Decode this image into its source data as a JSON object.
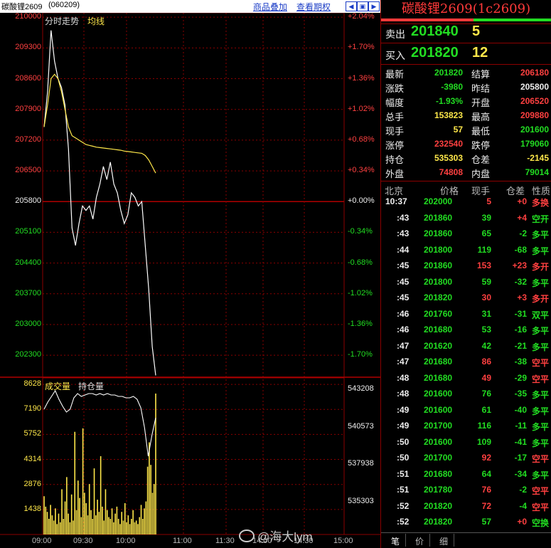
{
  "header": {
    "instrument": "碳酸锂2609",
    "code": "(060209)",
    "link_overlay": "商品叠加",
    "link_history": "查看期权"
  },
  "chart_data": [
    {
      "type": "line",
      "labels": [
        "分时走势",
        "均线"
      ],
      "x_ticks": [
        "09:00",
        "09:30",
        "10:00",
        "11:00",
        "11:30",
        "14:00",
        "14:30",
        "15:00"
      ],
      "y_ticks": [
        210000,
        209300,
        208600,
        207900,
        207200,
        206500,
        205800,
        205100,
        204400,
        203700,
        203000,
        202300
      ],
      "pct_ticks": [
        "+2.04%",
        "+1.70%",
        "+1.36%",
        "+1.02%",
        "+0.68%",
        "+0.34%",
        "+0.00%",
        "-0.34%",
        "-0.68%",
        "-1.02%",
        "-1.36%",
        "-1.70%"
      ],
      "baseline": 205800,
      "ylim": [
        201800,
        210100
      ],
      "series": [
        {
          "name": "分时走势",
          "color": "#ffffff",
          "values": [
            207500,
            208300,
            209700,
            209000,
            208600,
            208400,
            208000,
            207000,
            205200,
            204800,
            205300,
            205700,
            205600,
            205700,
            205400,
            205900,
            206200,
            206600,
            206300,
            206700,
            206200,
            206000,
            205600,
            205300,
            205500,
            206000,
            205900,
            205700,
            205800,
            204800,
            203800,
            202500,
            201840
          ]
        },
        {
          "name": "均线",
          "color": "#ffe84a",
          "values": [
            207500,
            208000,
            208600,
            208700,
            208600,
            208300,
            207900,
            207500,
            207300,
            207250,
            207200,
            207150,
            207100,
            207080,
            207060,
            207040,
            207030,
            207020,
            207010,
            207000,
            206990,
            206980,
            206970,
            206950,
            206940,
            206930,
            206920,
            206910,
            206900,
            206850,
            206750,
            206600,
            206450
          ]
        }
      ]
    },
    {
      "type": "bar",
      "labels": [
        "成交量",
        "持仓量"
      ],
      "vol_ticks": [
        8628,
        7190,
        5752,
        4314,
        2876,
        1438
      ],
      "oi_ticks": [
        543208,
        540573,
        537938,
        535303
      ],
      "ylim": [
        0,
        9000
      ],
      "oi_ylim": [
        533000,
        544000
      ],
      "volume": [
        2200,
        1600,
        1300,
        900,
        1700,
        1100,
        800,
        1500,
        600,
        1200,
        700,
        2600,
        900,
        1900,
        3300,
        1200,
        700,
        2300,
        800,
        5900,
        1400,
        3100,
        2100,
        1000,
        6100,
        2400,
        1800,
        1100,
        2900,
        1400,
        900,
        3800,
        1100,
        2000,
        1300,
        4500,
        1600,
        800,
        2600,
        1400,
        1000,
        900,
        1500,
        700,
        1200,
        1600,
        900,
        600,
        1300,
        800,
        1800,
        700,
        1100,
        600,
        900,
        1400,
        700,
        800,
        600,
        1000,
        1700,
        900,
        1500,
        1900,
        3900,
        5300,
        4000,
        2400,
        2900,
        8100
      ],
      "open_interest": [
        541800,
        542300,
        542700,
        543100,
        542500,
        542000,
        541600,
        541800,
        542600,
        542900,
        542700,
        542800,
        542900,
        542900,
        542800,
        542900,
        542800,
        542900,
        542800,
        542800,
        542700,
        542700,
        542600,
        542600,
        542700,
        542500,
        541900,
        540500,
        538500,
        540000,
        541200
      ]
    }
  ],
  "panel": {
    "title": "碳酸锂2609(1c2609)",
    "ask_label": "卖出",
    "ask_price": "201840",
    "ask_vol": "5",
    "bid_label": "买入",
    "bid_price": "201820",
    "bid_vol": "12",
    "quotes": [
      {
        "l1": "最新",
        "v1": "201820",
        "c1": "green",
        "l2": "结算",
        "v2": "206180",
        "c2": "red"
      },
      {
        "l1": "涨跌",
        "v1": "-3980",
        "c1": "green",
        "l2": "昨结",
        "v2": "205800",
        "c2": "white"
      },
      {
        "l1": "幅度",
        "v1": "-1.93%",
        "c1": "green",
        "l2": "开盘",
        "v2": "206520",
        "c2": "red"
      },
      {
        "l1": "总手",
        "v1": "153823",
        "c1": "yellow",
        "l2": "最高",
        "v2": "209880",
        "c2": "red"
      },
      {
        "l1": "现手",
        "v1": "57",
        "c1": "yellow",
        "l2": "最低",
        "v2": "201600",
        "c2": "green"
      },
      {
        "l1": "涨停",
        "v1": "232540",
        "c1": "red",
        "l2": "跌停",
        "v2": "179060",
        "c2": "green"
      },
      {
        "l1": "持仓",
        "v1": "535303",
        "c1": "yellow",
        "l2": "仓差",
        "v2": "-2145",
        "c2": "yellow"
      },
      {
        "l1": "外盘",
        "v1": "74808",
        "c1": "red",
        "l2": "内盘",
        "v2": "79014",
        "c2": "green"
      }
    ],
    "table_headers": [
      "北京",
      "价格",
      "现手",
      "仓差",
      "性质"
    ],
    "ticks": [
      {
        "t": "10:37",
        "p": "202000",
        "pc": "green",
        "v": "5",
        "vc": "red",
        "d": "+0",
        "n": "多换",
        "nc": "red"
      },
      {
        "t": ":43",
        "p": "201860",
        "pc": "green",
        "v": "39",
        "vc": "green",
        "d": "+4",
        "n": "空开",
        "nc": "green"
      },
      {
        "t": ":43",
        "p": "201860",
        "pc": "green",
        "v": "65",
        "vc": "green",
        "d": "-2",
        "n": "多平",
        "nc": "green"
      },
      {
        "t": ":44",
        "p": "201800",
        "pc": "green",
        "v": "119",
        "vc": "green",
        "d": "-68",
        "n": "多平",
        "nc": "green"
      },
      {
        "t": ":45",
        "p": "201860",
        "pc": "green",
        "v": "153",
        "vc": "red",
        "d": "+23",
        "n": "多开",
        "nc": "red"
      },
      {
        "t": ":45",
        "p": "201800",
        "pc": "green",
        "v": "59",
        "vc": "green",
        "d": "-32",
        "n": "多平",
        "nc": "green"
      },
      {
        "t": ":45",
        "p": "201820",
        "pc": "green",
        "v": "30",
        "vc": "red",
        "d": "+3",
        "n": "多开",
        "nc": "red"
      },
      {
        "t": ":46",
        "p": "201760",
        "pc": "green",
        "v": "31",
        "vc": "green",
        "d": "-31",
        "n": "双平",
        "nc": "green"
      },
      {
        "t": ":46",
        "p": "201680",
        "pc": "green",
        "v": "53",
        "vc": "green",
        "d": "-16",
        "n": "多平",
        "nc": "green"
      },
      {
        "t": ":47",
        "p": "201620",
        "pc": "green",
        "v": "42",
        "vc": "green",
        "d": "-21",
        "n": "多平",
        "nc": "green"
      },
      {
        "t": ":47",
        "p": "201680",
        "pc": "green",
        "v": "86",
        "vc": "red",
        "d": "-38",
        "n": "空平",
        "nc": "red"
      },
      {
        "t": ":48",
        "p": "201680",
        "pc": "green",
        "v": "49",
        "vc": "red",
        "d": "-29",
        "n": "空平",
        "nc": "red"
      },
      {
        "t": ":48",
        "p": "201600",
        "pc": "green",
        "v": "76",
        "vc": "green",
        "d": "-35",
        "n": "多平",
        "nc": "green"
      },
      {
        "t": ":49",
        "p": "201600",
        "pc": "green",
        "v": "61",
        "vc": "green",
        "d": "-40",
        "n": "多平",
        "nc": "green"
      },
      {
        "t": ":49",
        "p": "201700",
        "pc": "green",
        "v": "116",
        "vc": "green",
        "d": "-11",
        "n": "多平",
        "nc": "green"
      },
      {
        "t": ":50",
        "p": "201600",
        "pc": "green",
        "v": "109",
        "vc": "green",
        "d": "-41",
        "n": "多平",
        "nc": "green"
      },
      {
        "t": ":50",
        "p": "201700",
        "pc": "green",
        "v": "92",
        "vc": "red",
        "d": "-17",
        "n": "空平",
        "nc": "red"
      },
      {
        "t": ":51",
        "p": "201680",
        "pc": "green",
        "v": "64",
        "vc": "green",
        "d": "-34",
        "n": "多平",
        "nc": "green"
      },
      {
        "t": ":51",
        "p": "201780",
        "pc": "green",
        "v": "76",
        "vc": "red",
        "d": "-2",
        "n": "空平",
        "nc": "red"
      },
      {
        "t": ":52",
        "p": "201820",
        "pc": "green",
        "v": "72",
        "vc": "red",
        "d": "-4",
        "n": "空平",
        "nc": "red"
      },
      {
        "t": ":52",
        "p": "201820",
        "pc": "green",
        "v": "57",
        "vc": "green",
        "d": "+0",
        "n": "空换",
        "nc": "green"
      }
    ],
    "tabs": [
      "笔",
      "价",
      "细"
    ]
  },
  "watermark": "@海大lym",
  "colors": {
    "up": "#ff4040",
    "down": "#22dd22",
    "grid": "#8b0000",
    "avg": "#ffe84a"
  }
}
